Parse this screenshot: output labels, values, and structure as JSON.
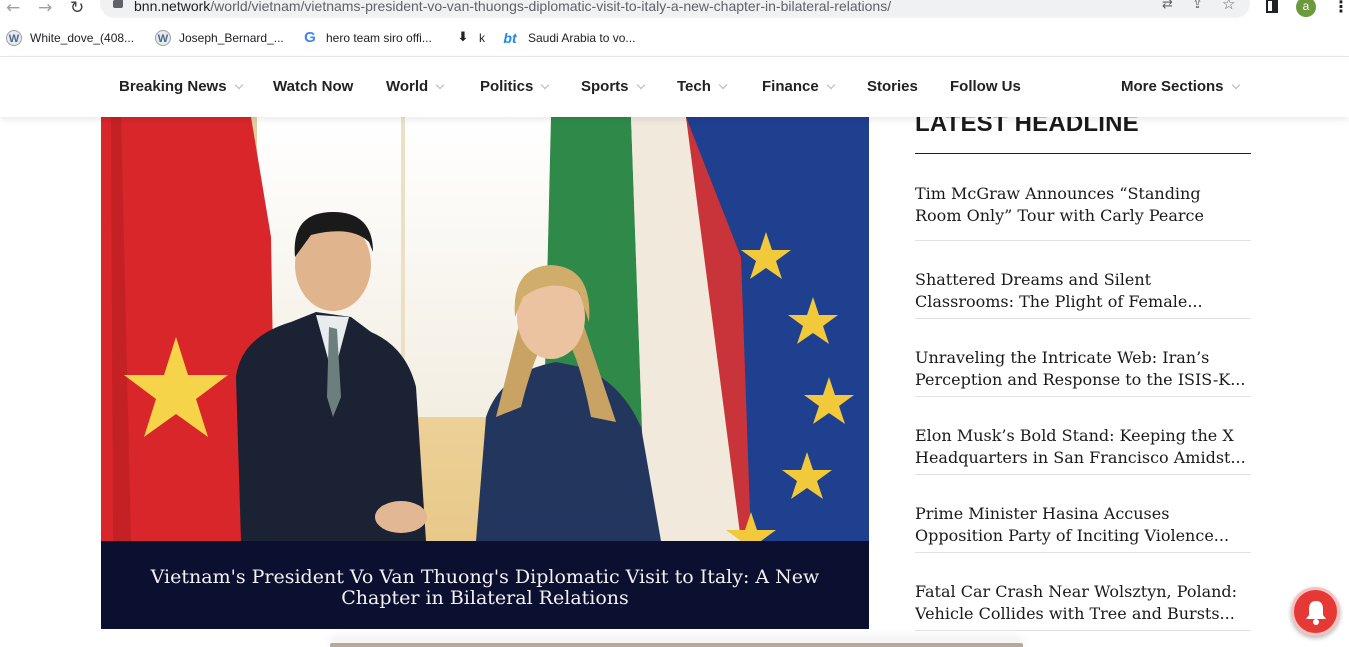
{
  "browser": {
    "url_host": "bnn.network",
    "url_path": "/world/vietnam/vietnams-president-vo-van-thuongs-diplomatic-visit-to-italy-a-new-chapter-in-bilateral-relations/",
    "profile_initial": "a",
    "bookmarks": [
      {
        "label": "White_dove_(408...",
        "icon": "wikipedia-icon"
      },
      {
        "label": "Joseph_Bernard_...",
        "icon": "wikipedia-icon"
      },
      {
        "label": "hero team siro offi...",
        "icon": "google-icon"
      },
      {
        "label": "k",
        "icon": "download-icon"
      },
      {
        "label": "Saudi Arabia to vo...",
        "icon": "bt-icon"
      }
    ]
  },
  "site_nav": {
    "items": [
      {
        "label": "Breaking News",
        "has_dropdown": true
      },
      {
        "label": "Watch Now",
        "has_dropdown": false
      },
      {
        "label": "World",
        "has_dropdown": true
      },
      {
        "label": "Politics",
        "has_dropdown": true
      },
      {
        "label": "Sports",
        "has_dropdown": true
      },
      {
        "label": "Tech",
        "has_dropdown": true
      },
      {
        "label": "Finance",
        "has_dropdown": true
      },
      {
        "label": "Stories",
        "has_dropdown": false
      },
      {
        "label": "Follow Us",
        "has_dropdown": false
      },
      {
        "label": "More Sections",
        "has_dropdown": true
      }
    ]
  },
  "article": {
    "image_caption": "Vietnam's President Vo Van Thuong's Diplomatic Visit to Italy: A New Chapter in Bilateral Relations"
  },
  "sidebar": {
    "title": "LATEST HEADLINE",
    "headlines": [
      "Tim McGraw Announces “Standing Room Only” Tour with Carly Pearce",
      "Shattered Dreams and Silent Classrooms: The Plight of Female...",
      "Unraveling the Intricate Web: Iran’s Perception and Response to the ISIS-K...",
      "Elon Musk’s Bold Stand: Keeping the X Headquarters in San Francisco Amidst...",
      "Prime Minister Hasina Accuses Opposition Party of Inciting Violence...",
      "Fatal Car Crash Near Wolsztyn, Poland: Vehicle Collides with Tree and Bursts..."
    ]
  },
  "colors": {
    "caption_band": "#0b1031",
    "notification_bell": "#e53935",
    "vietnam_red": "#d8262a",
    "eu_blue": "#1f3f8f"
  }
}
